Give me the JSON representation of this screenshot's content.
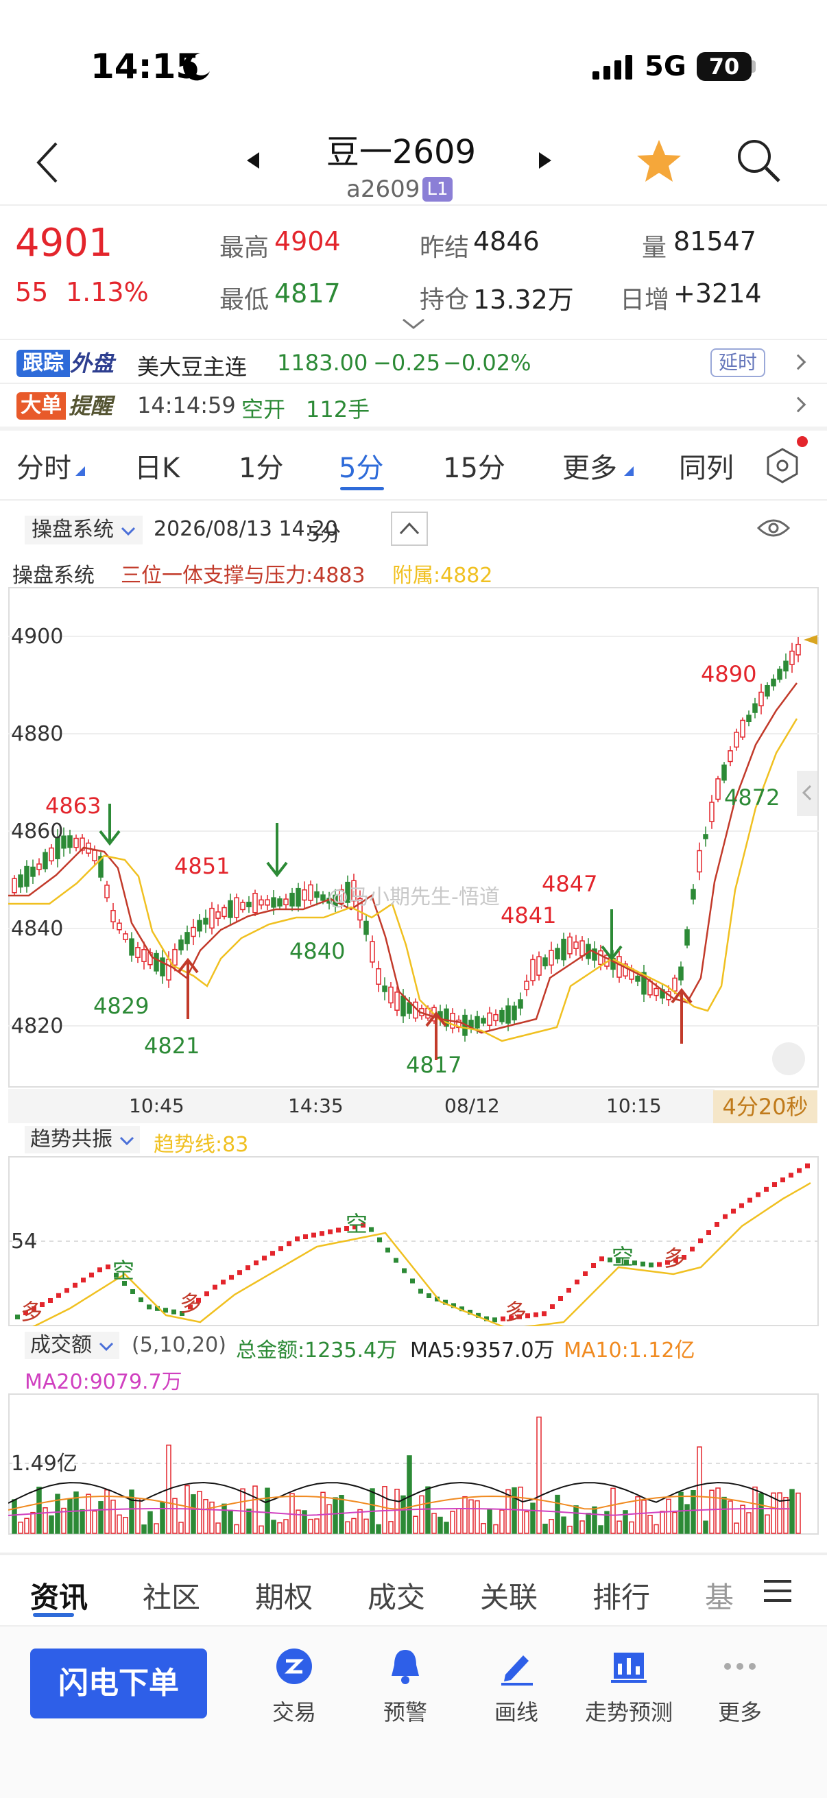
{
  "status": {
    "time": "14:15",
    "network": "5G",
    "battery": "70"
  },
  "header": {
    "name": "豆一2609",
    "code": "a2609",
    "level": "L1"
  },
  "quote": {
    "last": "4901",
    "change": "55",
    "change_pct": "1.13%",
    "high_label": "最高",
    "high": "4904",
    "low_label": "最低",
    "low": "4817",
    "settle_label": "昨结",
    "settle": "4846",
    "oi_label": "持仓",
    "oi": "13.32万",
    "vol_label": "量",
    "vol": "81547",
    "daily_inc_label": "日增",
    "daily_inc": "+3214"
  },
  "track": {
    "badge1": "跟踪",
    "badge2": "外盘",
    "name": "美大豆主连",
    "price": "1183.00",
    "change": "−0.25",
    "pct": "−0.02%",
    "delay": "延时"
  },
  "bigorder": {
    "badge1": "大单",
    "badge2": "提醒",
    "time": "14:14:59",
    "type": "空开",
    "qty": "112手"
  },
  "tabs": [
    "分时",
    "日K",
    "1分",
    "5分",
    "15分",
    "更多",
    "同列"
  ],
  "chart_header": {
    "indicator": "操盘系统",
    "datetime": "2026/08/13 14:20",
    "period": "5分"
  },
  "indicator_line": {
    "title": "操盘系统",
    "line1": "三位一体支撑与压力:4883",
    "line2": "附属:4882"
  },
  "price_axis": [
    "4900",
    "4880",
    "4860",
    "4840",
    "4820"
  ],
  "time_axis": [
    "10:45",
    "14:35",
    "08/12",
    "10:15"
  ],
  "price_annotations": [
    "4863",
    "4851",
    "4829",
    "4821",
    "4840",
    "4841",
    "4847",
    "4817",
    "4890",
    "4872"
  ],
  "watermark": "@马小期先生-悟道",
  "timer": "4分20秒",
  "trend": {
    "indicator": "趋势共振",
    "value": "趋势线:83",
    "axis": "54",
    "signals": [
      "多",
      "空",
      "多",
      "空",
      "多",
      "空",
      "多"
    ]
  },
  "volume": {
    "indicator": "成交额",
    "params": "(5,10,20)",
    "total": "总金额:1235.4万",
    "ma5": "MA5:9357.0万",
    "ma10": "MA10:1.12亿",
    "ma20": "MA20:9079.7万",
    "axis": "1.49亿"
  },
  "bottom_tabs": [
    "资讯",
    "社区",
    "期权",
    "成交",
    "关联",
    "排行",
    "基"
  ],
  "bottom_nav": {
    "order": "闪电下单",
    "items": [
      "交易",
      "预警",
      "画线",
      "走势预测",
      "更多"
    ]
  },
  "colors": {
    "up": "#e3252c",
    "down": "#2c8a36",
    "accent": "#2e6bd9",
    "ma_red": "#c23a2a",
    "ma_yellow": "#f0c020"
  }
}
